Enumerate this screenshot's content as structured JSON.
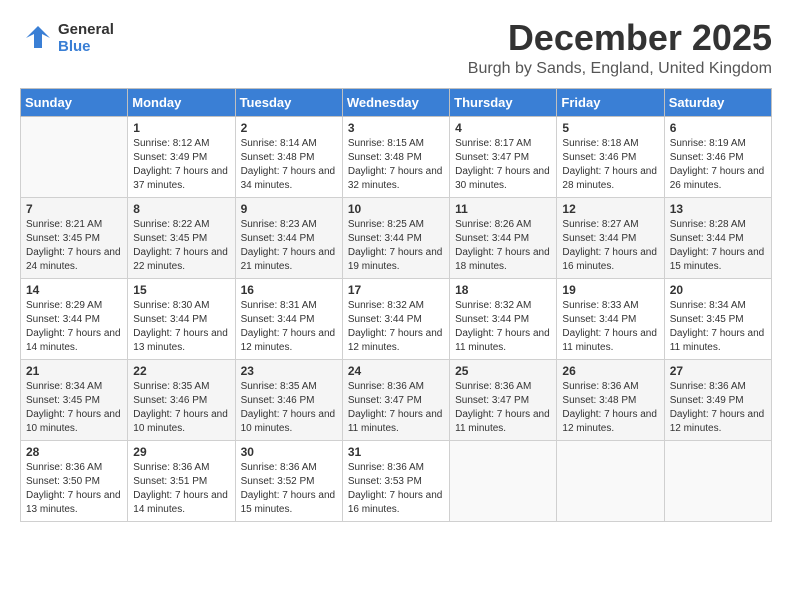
{
  "header": {
    "logo_general": "General",
    "logo_blue": "Blue",
    "month_title": "December 2025",
    "subtitle": "Burgh by Sands, England, United Kingdom"
  },
  "calendar": {
    "days_of_week": [
      "Sunday",
      "Monday",
      "Tuesday",
      "Wednesday",
      "Thursday",
      "Friday",
      "Saturday"
    ],
    "weeks": [
      [
        {
          "day": "",
          "sunrise": "",
          "sunset": "",
          "daylight": ""
        },
        {
          "day": "1",
          "sunrise": "Sunrise: 8:12 AM",
          "sunset": "Sunset: 3:49 PM",
          "daylight": "Daylight: 7 hours and 37 minutes."
        },
        {
          "day": "2",
          "sunrise": "Sunrise: 8:14 AM",
          "sunset": "Sunset: 3:48 PM",
          "daylight": "Daylight: 7 hours and 34 minutes."
        },
        {
          "day": "3",
          "sunrise": "Sunrise: 8:15 AM",
          "sunset": "Sunset: 3:48 PM",
          "daylight": "Daylight: 7 hours and 32 minutes."
        },
        {
          "day": "4",
          "sunrise": "Sunrise: 8:17 AM",
          "sunset": "Sunset: 3:47 PM",
          "daylight": "Daylight: 7 hours and 30 minutes."
        },
        {
          "day": "5",
          "sunrise": "Sunrise: 8:18 AM",
          "sunset": "Sunset: 3:46 PM",
          "daylight": "Daylight: 7 hours and 28 minutes."
        },
        {
          "day": "6",
          "sunrise": "Sunrise: 8:19 AM",
          "sunset": "Sunset: 3:46 PM",
          "daylight": "Daylight: 7 hours and 26 minutes."
        }
      ],
      [
        {
          "day": "7",
          "sunrise": "Sunrise: 8:21 AM",
          "sunset": "Sunset: 3:45 PM",
          "daylight": "Daylight: 7 hours and 24 minutes."
        },
        {
          "day": "8",
          "sunrise": "Sunrise: 8:22 AM",
          "sunset": "Sunset: 3:45 PM",
          "daylight": "Daylight: 7 hours and 22 minutes."
        },
        {
          "day": "9",
          "sunrise": "Sunrise: 8:23 AM",
          "sunset": "Sunset: 3:44 PM",
          "daylight": "Daylight: 7 hours and 21 minutes."
        },
        {
          "day": "10",
          "sunrise": "Sunrise: 8:25 AM",
          "sunset": "Sunset: 3:44 PM",
          "daylight": "Daylight: 7 hours and 19 minutes."
        },
        {
          "day": "11",
          "sunrise": "Sunrise: 8:26 AM",
          "sunset": "Sunset: 3:44 PM",
          "daylight": "Daylight: 7 hours and 18 minutes."
        },
        {
          "day": "12",
          "sunrise": "Sunrise: 8:27 AM",
          "sunset": "Sunset: 3:44 PM",
          "daylight": "Daylight: 7 hours and 16 minutes."
        },
        {
          "day": "13",
          "sunrise": "Sunrise: 8:28 AM",
          "sunset": "Sunset: 3:44 PM",
          "daylight": "Daylight: 7 hours and 15 minutes."
        }
      ],
      [
        {
          "day": "14",
          "sunrise": "Sunrise: 8:29 AM",
          "sunset": "Sunset: 3:44 PM",
          "daylight": "Daylight: 7 hours and 14 minutes."
        },
        {
          "day": "15",
          "sunrise": "Sunrise: 8:30 AM",
          "sunset": "Sunset: 3:44 PM",
          "daylight": "Daylight: 7 hours and 13 minutes."
        },
        {
          "day": "16",
          "sunrise": "Sunrise: 8:31 AM",
          "sunset": "Sunset: 3:44 PM",
          "daylight": "Daylight: 7 hours and 12 minutes."
        },
        {
          "day": "17",
          "sunrise": "Sunrise: 8:32 AM",
          "sunset": "Sunset: 3:44 PM",
          "daylight": "Daylight: 7 hours and 12 minutes."
        },
        {
          "day": "18",
          "sunrise": "Sunrise: 8:32 AM",
          "sunset": "Sunset: 3:44 PM",
          "daylight": "Daylight: 7 hours and 11 minutes."
        },
        {
          "day": "19",
          "sunrise": "Sunrise: 8:33 AM",
          "sunset": "Sunset: 3:44 PM",
          "daylight": "Daylight: 7 hours and 11 minutes."
        },
        {
          "day": "20",
          "sunrise": "Sunrise: 8:34 AM",
          "sunset": "Sunset: 3:45 PM",
          "daylight": "Daylight: 7 hours and 11 minutes."
        }
      ],
      [
        {
          "day": "21",
          "sunrise": "Sunrise: 8:34 AM",
          "sunset": "Sunset: 3:45 PM",
          "daylight": "Daylight: 7 hours and 10 minutes."
        },
        {
          "day": "22",
          "sunrise": "Sunrise: 8:35 AM",
          "sunset": "Sunset: 3:46 PM",
          "daylight": "Daylight: 7 hours and 10 minutes."
        },
        {
          "day": "23",
          "sunrise": "Sunrise: 8:35 AM",
          "sunset": "Sunset: 3:46 PM",
          "daylight": "Daylight: 7 hours and 10 minutes."
        },
        {
          "day": "24",
          "sunrise": "Sunrise: 8:36 AM",
          "sunset": "Sunset: 3:47 PM",
          "daylight": "Daylight: 7 hours and 11 minutes."
        },
        {
          "day": "25",
          "sunrise": "Sunrise: 8:36 AM",
          "sunset": "Sunset: 3:47 PM",
          "daylight": "Daylight: 7 hours and 11 minutes."
        },
        {
          "day": "26",
          "sunrise": "Sunrise: 8:36 AM",
          "sunset": "Sunset: 3:48 PM",
          "daylight": "Daylight: 7 hours and 12 minutes."
        },
        {
          "day": "27",
          "sunrise": "Sunrise: 8:36 AM",
          "sunset": "Sunset: 3:49 PM",
          "daylight": "Daylight: 7 hours and 12 minutes."
        }
      ],
      [
        {
          "day": "28",
          "sunrise": "Sunrise: 8:36 AM",
          "sunset": "Sunset: 3:50 PM",
          "daylight": "Daylight: 7 hours and 13 minutes."
        },
        {
          "day": "29",
          "sunrise": "Sunrise: 8:36 AM",
          "sunset": "Sunset: 3:51 PM",
          "daylight": "Daylight: 7 hours and 14 minutes."
        },
        {
          "day": "30",
          "sunrise": "Sunrise: 8:36 AM",
          "sunset": "Sunset: 3:52 PM",
          "daylight": "Daylight: 7 hours and 15 minutes."
        },
        {
          "day": "31",
          "sunrise": "Sunrise: 8:36 AM",
          "sunset": "Sunset: 3:53 PM",
          "daylight": "Daylight: 7 hours and 16 minutes."
        },
        {
          "day": "",
          "sunrise": "",
          "sunset": "",
          "daylight": ""
        },
        {
          "day": "",
          "sunrise": "",
          "sunset": "",
          "daylight": ""
        },
        {
          "day": "",
          "sunrise": "",
          "sunset": "",
          "daylight": ""
        }
      ]
    ]
  }
}
